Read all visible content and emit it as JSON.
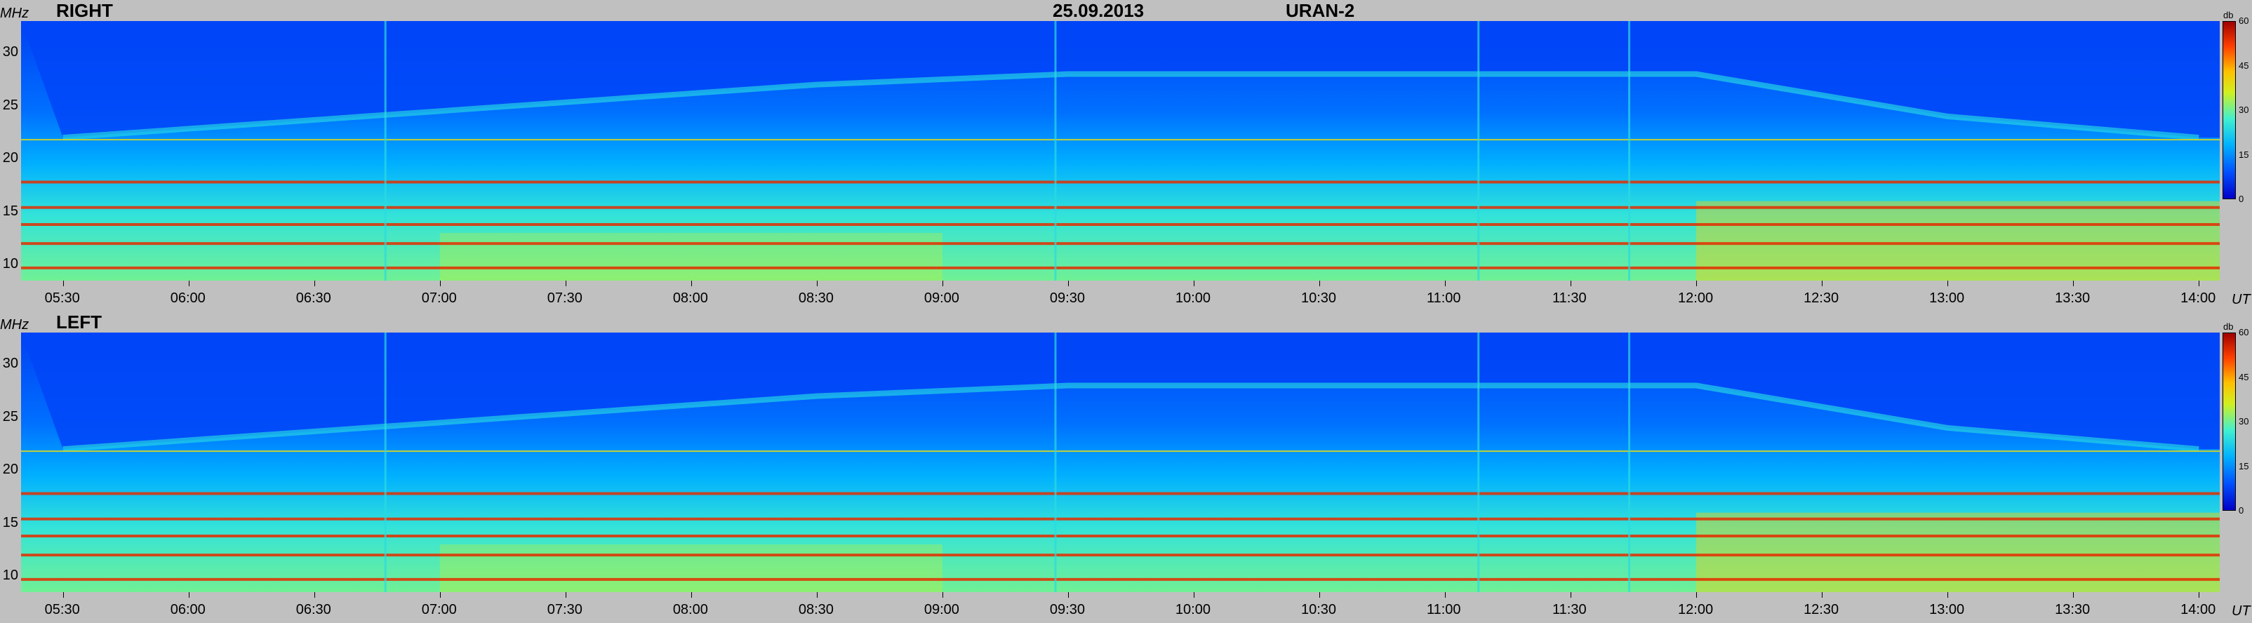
{
  "header": {
    "date": "25.09.2013",
    "instrument": "URAN-2"
  },
  "colorbar": {
    "unit": "db",
    "ticks": [
      "0",
      "15",
      "30",
      "45",
      "60"
    ],
    "range": [
      0,
      60
    ]
  },
  "axes": {
    "y_unit": "MHz",
    "x_unit": "UT"
  },
  "chart_data": [
    {
      "type": "heatmap",
      "title": "RIGHT",
      "xlabel": "UT",
      "ylabel": "MHz",
      "ylim": [
        8.5,
        33
      ],
      "xlim": [
        "05:20",
        "14:05"
      ],
      "yticks": [
        "10",
        "15",
        "20",
        "25",
        "30"
      ],
      "xticks": [
        "05:30",
        "06:00",
        "06:30",
        "07:00",
        "07:30",
        "08:00",
        "08:30",
        "09:00",
        "09:30",
        "10:00",
        "10:30",
        "11:00",
        "11:30",
        "12:00",
        "12:30",
        "13:00",
        "13:30",
        "14:00"
      ],
      "colorbar_label": "db",
      "color_range": [
        0,
        60
      ],
      "interference_bands_mhz": [
        9.7,
        12.0,
        13.8,
        15.4,
        17.8,
        21.8
      ],
      "ionospheric_cutoff_mhz": {
        "05:30": 22,
        "08:30": 27,
        "09:30": 28,
        "12:00": 28,
        "13:00": 24,
        "14:00": 22
      }
    },
    {
      "type": "heatmap",
      "title": "LEFT",
      "xlabel": "UT",
      "ylabel": "MHz",
      "ylim": [
        8.5,
        33
      ],
      "xlim": [
        "05:20",
        "14:05"
      ],
      "yticks": [
        "10",
        "15",
        "20",
        "25",
        "30"
      ],
      "xticks": [
        "05:30",
        "06:00",
        "06:30",
        "07:00",
        "07:30",
        "08:00",
        "08:30",
        "09:00",
        "09:30",
        "10:00",
        "10:30",
        "11:00",
        "11:30",
        "12:00",
        "12:30",
        "13:00",
        "13:30",
        "14:00"
      ],
      "colorbar_label": "db",
      "color_range": [
        0,
        60
      ],
      "interference_bands_mhz": [
        9.7,
        12.0,
        13.8,
        15.4,
        17.8,
        21.8
      ],
      "ionospheric_cutoff_mhz": {
        "05:30": 22,
        "08:30": 27,
        "09:30": 28,
        "12:00": 28,
        "13:00": 24,
        "14:00": 22
      }
    }
  ]
}
